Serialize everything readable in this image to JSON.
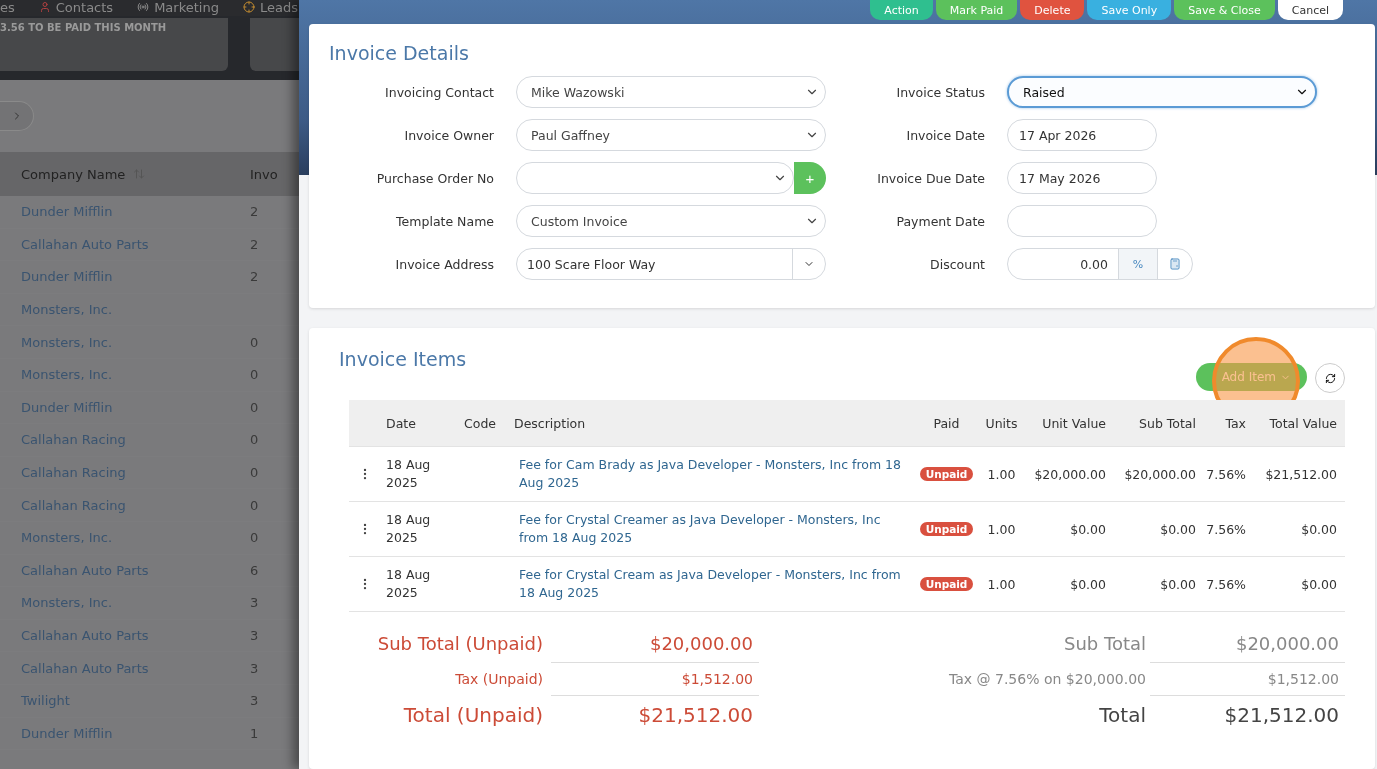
{
  "nav": [
    {
      "label": "es",
      "kind": "plain"
    },
    {
      "label": "Contacts",
      "kind": "contacts"
    },
    {
      "label": "Marketing",
      "kind": "marketing"
    },
    {
      "label": "Leads",
      "kind": "leads"
    }
  ],
  "banner": "3.56 TO BE PAID THIS MONTH",
  "background_table": {
    "columns": [
      "Company Name",
      "Invo"
    ],
    "rows": [
      {
        "company": "Dunder Mifflin",
        "column_2": "2"
      },
      {
        "company": "Callahan Auto Parts",
        "column_2": "2"
      },
      {
        "company": "Dunder Mifflin",
        "column_2": "2"
      },
      {
        "company": "Monsters, Inc."
      },
      {
        "company": "Monsters, Inc.",
        "column_2": "0"
      },
      {
        "company": "Monsters, Inc.",
        "column_2": "0"
      },
      {
        "company": "Dunder Mifflin",
        "column_2": "0"
      },
      {
        "company": "Callahan Racing",
        "column_2": "0"
      },
      {
        "company": "Callahan Racing",
        "column_2": "0"
      },
      {
        "company": "Callahan Racing",
        "column_2": "0"
      },
      {
        "company": "Monsters, Inc.",
        "column_2": "0"
      },
      {
        "company": "Callahan Auto Parts",
        "column_2": "6"
      },
      {
        "company": "Monsters, Inc.",
        "column_2": "3"
      },
      {
        "company": "Callahan Auto Parts",
        "column_2": "3"
      },
      {
        "company": "Callahan Auto Parts",
        "column_2": "3"
      },
      {
        "company": "Twilight",
        "column_2": "3"
      },
      {
        "company": "Dunder Mifflin",
        "column_2": "1"
      }
    ]
  },
  "actions": [
    {
      "label": "Action",
      "color": "#2fbf8f"
    },
    {
      "label": "Mark Paid",
      "color": "#5cc15c"
    },
    {
      "label": "Delete",
      "color": "#e0533f"
    },
    {
      "label": "Save Only",
      "color": "#39b0e0"
    },
    {
      "label": "Save & Close",
      "color": "#5cc15c"
    },
    {
      "label": "Cancel",
      "color": "#ffffff"
    }
  ],
  "invoice_details": {
    "title": "Invoice Details",
    "left_fields": [
      {
        "label": "Invoicing Contact",
        "kind": "select",
        "value": "Mike Wazowski",
        "focused": false
      },
      {
        "label": "Invoice Owner",
        "kind": "select",
        "value": "Paul Gaffney",
        "focused": false
      },
      {
        "label": "Purchase Order No",
        "kind": "select_add",
        "add": "+",
        "focused": false
      },
      {
        "label": "Template Name",
        "kind": "select",
        "value": "Custom Invoice",
        "focused": false
      },
      {
        "label": "Invoice Address",
        "kind": "combo",
        "value": "100 Scare Floor Way",
        "focused": false
      }
    ],
    "right_fields": [
      {
        "label": "Invoice Status",
        "kind": "select",
        "value": "Raised",
        "focused": true
      },
      {
        "label": "Invoice Date",
        "kind": "date",
        "value": "17 Apr 2026",
        "focused": false
      },
      {
        "label": "Invoice Due Date",
        "kind": "date",
        "value": "17 May 2026",
        "focused": false
      },
      {
        "label": "Payment Date",
        "kind": "date",
        "focused": false
      },
      {
        "label": "Discount",
        "kind": "discount",
        "value": "0.00",
        "suffix": "%",
        "focused": false
      }
    ]
  },
  "invoice_items": {
    "title": "Invoice Items",
    "add_button": {
      "label": "Add Item",
      "highlighted": true
    },
    "columns": [
      "Date",
      "Code",
      "Description",
      "Paid",
      "Units",
      "Unit Value",
      "Sub Total",
      "Tax",
      "Total Value"
    ],
    "rows": [
      {
        "date": "18 Aug 2025",
        "description": "Fee for Cam Brady as Java Developer - Monsters, Inc from 18 Aug 2025",
        "paid": "Unpaid",
        "units": "1.00",
        "unit_value": "$20,000.00",
        "sub_total": "$20,000.00",
        "tax": "7.56%",
        "total": "$21,512.00"
      },
      {
        "date": "18 Aug 2025",
        "description": "Fee for Crystal Creamer as Java Developer - Monsters, Inc from 18 Aug 2025",
        "paid": "Unpaid",
        "units": "1.00",
        "unit_value": "$0.00",
        "sub_total": "$0.00",
        "tax": "7.56%",
        "total": "$0.00"
      },
      {
        "date": "18 Aug 2025",
        "description": "Fee for Crystal Cream as Java Developer - Monsters, Inc from 18 Aug 2025",
        "paid": "Unpaid",
        "units": "1.00",
        "unit_value": "$0.00",
        "sub_total": "$0.00",
        "tax": "7.56%",
        "total": "$0.00"
      }
    ]
  },
  "totals_unpaid": [
    {
      "label": "Sub Total (Unpaid)",
      "value": "$20,000.00",
      "kind": "main"
    },
    {
      "label": "Tax (Unpaid)",
      "value": "$1,512.00",
      "kind": "minor"
    },
    {
      "label": "Total (Unpaid)",
      "value": "$21,512.00",
      "kind": "grand"
    }
  ],
  "totals": [
    {
      "label": "Sub Total",
      "value": "$20,000.00",
      "kind": "main"
    },
    {
      "label": "Tax @ 7.56% on $20,000.00",
      "value": "$1,512.00",
      "kind": "minor"
    },
    {
      "label": "Total",
      "value": "$21,512.00",
      "kind": "grand"
    }
  ]
}
